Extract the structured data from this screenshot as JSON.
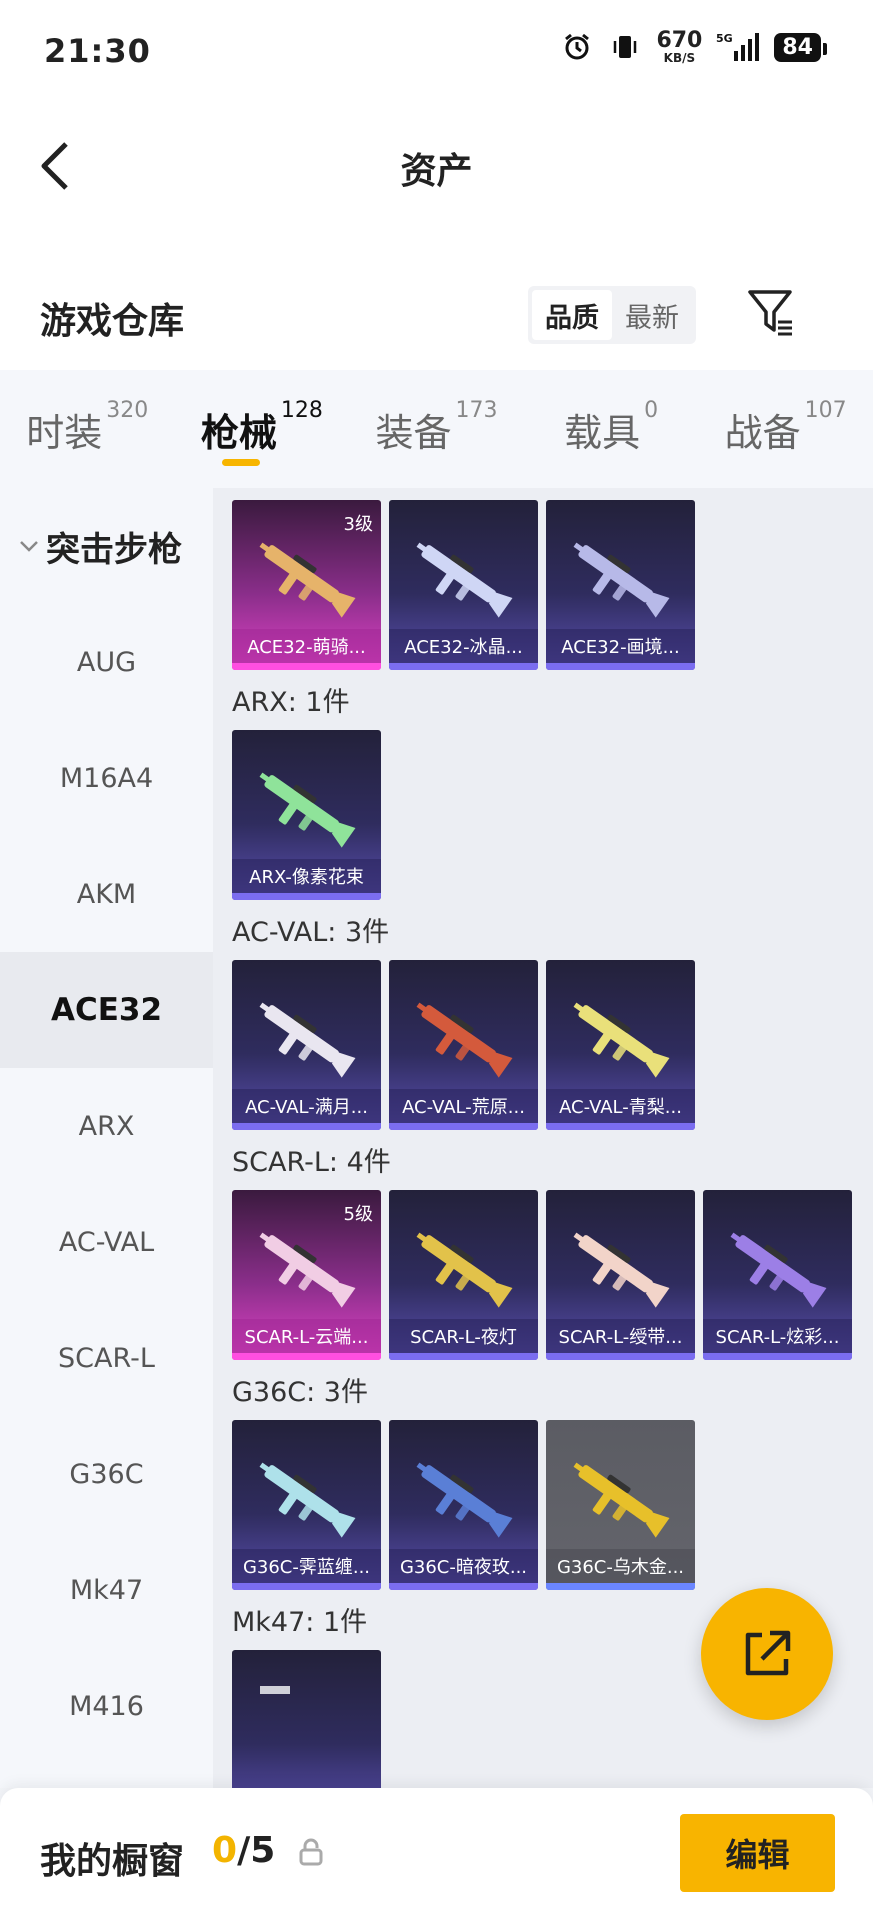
{
  "status": {
    "time": "21:30",
    "speed_num": "670",
    "speed_unit": "KB/S",
    "network": "5G",
    "battery": "84"
  },
  "header": {
    "title": "资产"
  },
  "section": {
    "title": "游戏仓库",
    "sort_options": [
      "品质",
      "最新"
    ]
  },
  "tabs": [
    {
      "label": "时装",
      "count": "320"
    },
    {
      "label": "枪械",
      "count": "128"
    },
    {
      "label": "装备",
      "count": "173"
    },
    {
      "label": "载具",
      "count": "0"
    },
    {
      "label": "战备",
      "count": "107"
    }
  ],
  "sidebar": {
    "group": "突击步枪",
    "items": [
      "AUG",
      "M16A4",
      "AKM",
      "ACE32",
      "ARX",
      "AC-VAL",
      "SCAR-L",
      "G36C",
      "Mk47",
      "M416"
    ],
    "active": "ACE32"
  },
  "groups": [
    {
      "label": "",
      "cards": [
        {
          "name": "ACE32-萌骑...",
          "level": "3级",
          "style": "pink"
        },
        {
          "name": "ACE32-冰晶...",
          "level": "",
          "style": "purple"
        },
        {
          "name": "ACE32-画境...",
          "level": "",
          "style": "purple"
        }
      ]
    },
    {
      "label": "ARX: 1件",
      "cards": [
        {
          "name": "ARX-像素花束",
          "level": "",
          "style": "purple"
        }
      ]
    },
    {
      "label": "AC-VAL: 3件",
      "cards": [
        {
          "name": "AC-VAL-满月...",
          "level": "",
          "style": "purple"
        },
        {
          "name": "AC-VAL-荒原...",
          "level": "",
          "style": "purple"
        },
        {
          "name": "AC-VAL-青梨...",
          "level": "",
          "style": "purple"
        }
      ]
    },
    {
      "label": "SCAR-L: 4件",
      "cards": [
        {
          "name": "SCAR-L-云端...",
          "level": "5级",
          "style": "pink"
        },
        {
          "name": "SCAR-L-夜灯",
          "level": "",
          "style": "purple"
        },
        {
          "name": "SCAR-L-绶带...",
          "level": "",
          "style": "purple"
        },
        {
          "name": "SCAR-L-炫彩...",
          "level": "",
          "style": "purple"
        }
      ]
    },
    {
      "label": "G36C: 3件",
      "cards": [
        {
          "name": "G36C-霁蓝缠...",
          "level": "",
          "style": "purple"
        },
        {
          "name": "G36C-暗夜玫...",
          "level": "",
          "style": "purple"
        },
        {
          "name": "G36C-乌木金...",
          "level": "",
          "style": "grey"
        }
      ]
    },
    {
      "label": "Mk47: 1件",
      "cards": []
    }
  ],
  "bottom": {
    "label": "我的橱窗",
    "current": "0",
    "total": "/5",
    "edit": "编辑"
  },
  "colors": {
    "accent": "#f8b400",
    "card_purple_bar": "#7b6df0",
    "card_pink_bar": "#ff4fe0"
  }
}
